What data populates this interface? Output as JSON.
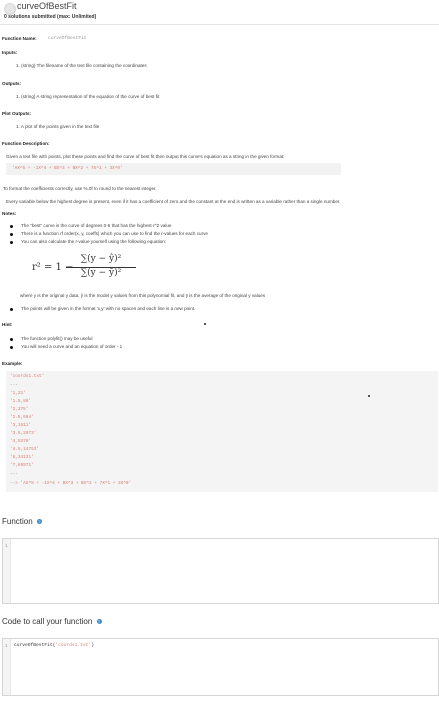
{
  "header": {
    "title": "curveOfBestFit",
    "submissions": "0 solutions submitted (max: Unlimited)"
  },
  "spec": {
    "function_name_label": "Function Name:",
    "function_name_value": "curveOfBestFit",
    "inputs_label": "Inputs:",
    "input_1": "1. (string) The filename of the text file containing the coordinates",
    "outputs_label": "Outputs:",
    "output_1": "1. (string) A string representation of the equation of the curve of best fit",
    "plot_outputs_label": "Plot Outputs:",
    "plot_output_1": "1. A plot of the points given in the text file",
    "description_label": "Function Description:",
    "description_text": "Given a text file with points, plot these points and find the curve of best fit then output this curve's equation as a string in the given format:",
    "format_code": "'AX^5 + -1X^4 + BX^3 + BX^2 + 7X^1 + 3X^0'",
    "rounding_text": "To format the coefficients correctly, use %.0f to round to the nearest integer.",
    "variable_text": "Every variable below the highest degree is present, even if it has a coefficient of zero and the constant at the end is written as a variable rather than a single number.",
    "notes_label": "Notes:",
    "notes": [
      "The \"best\" curve is the curve of degrees 0-5 that has the highest r^2 value",
      "There is a function rf order(x, y, coeffs) which you can use to find the r-values for each curve",
      "You can also calculate the r-value yourself using the following equation:"
    ],
    "formula": {
      "lhs": "r² = 1 −",
      "numerator": "∑(y − ŷ)²",
      "denominator": "∑(y − ȳ)²"
    },
    "where_text": "where y is the original y data, ŷ is the model y values from this polynomial fit, and ȳ is the average of the original y values",
    "points_note": "The points will be given in the format 'x,y' with no spaces and each line is a new point.",
    "hint_label": "Hint:",
    "hints": [
      "The function polyfit() may be useful",
      "You will need a curve and an equation of order - 1"
    ],
    "example_label": "Example:",
    "example_lines": [
      "'coords1.txt'",
      "---",
      "'1,21'",
      "'1.5,88'",
      "'2,275'",
      "'2.5,694'",
      "'3,1511'",
      "'3.5,2973'",
      "'4,5379'",
      "'4.5,14753'",
      "'6,34131'",
      "'7,69971'",
      "---",
      "--> 'AX^5 + -1X^4 + BX^3 + BX^2 + 7X^1 + 3X^0'"
    ]
  },
  "function_section": {
    "title": "Function",
    "help_icon": "question-circle-icon",
    "line_number": "1"
  },
  "call_section": {
    "title": "Code to call your function",
    "help_icon": "question-circle-icon",
    "line_number": "1",
    "code_fn": "curveOfBestFit(",
    "code_arg": "'coords1.txt'",
    "code_end": ")"
  }
}
